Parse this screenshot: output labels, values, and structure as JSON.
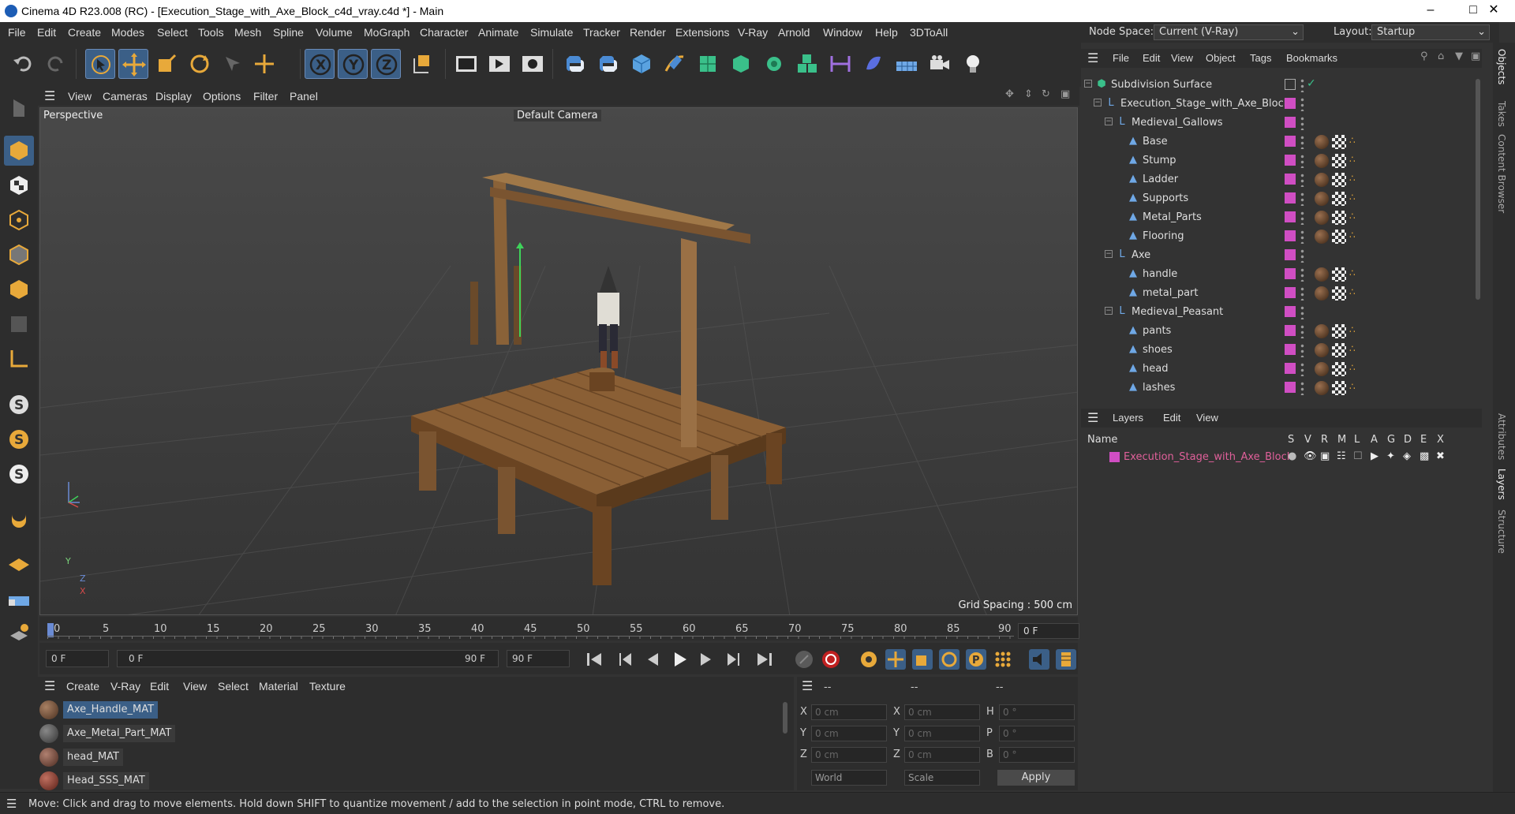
{
  "window": {
    "title": "Cinema 4D R23.008 (RC) - [Execution_Stage_with_Axe_Block_c4d_vray.c4d *] - Main",
    "minimize": "–",
    "maximize": "□",
    "close": "✕"
  },
  "menu": [
    "File",
    "Edit",
    "Create",
    "Modes",
    "Select",
    "Tools",
    "Mesh",
    "Spline",
    "Volume",
    "MoGraph",
    "Character",
    "Animate",
    "Simulate",
    "Tracker",
    "Render",
    "Extensions",
    "V-Ray",
    "Arnold",
    "Window",
    "Help",
    "3DToAll"
  ],
  "node_space": {
    "label": "Node Space:",
    "value": "Current (V-Ray)"
  },
  "layout": {
    "label": "Layout:",
    "value": "Startup"
  },
  "viewport_menu": [
    "View",
    "Cameras",
    "Display",
    "Options",
    "Filter",
    "Panel"
  ],
  "viewport": {
    "label": "Perspective",
    "camera": "Default Camera",
    "grid_spacing": "Grid Spacing : 500 cm",
    "axes": [
      "Y",
      "Z",
      "X"
    ]
  },
  "timeline": {
    "ticks": [
      "0",
      "5",
      "10",
      "15",
      "20",
      "25",
      "30",
      "35",
      "40",
      "45",
      "50",
      "55",
      "60",
      "65",
      "70",
      "75",
      "80",
      "85",
      "90"
    ],
    "current_frame": "0 F"
  },
  "transport": {
    "start": "0 F",
    "range_start": "0 F",
    "range_end": "90 F",
    "end": "90 F"
  },
  "material_menu": [
    "Create",
    "V-Ray",
    "Edit",
    "View",
    "Select",
    "Material",
    "Texture"
  ],
  "materials": [
    {
      "name": "Axe_Handle_MAT",
      "selected": true
    },
    {
      "name": "Axe_Metal_Part_MAT",
      "selected": false
    },
    {
      "name": "head_MAT",
      "selected": false
    },
    {
      "name": "Head_SSS_MAT",
      "selected": false
    }
  ],
  "coords": {
    "header": [
      "--",
      "--",
      "--"
    ],
    "rows": [
      {
        "a": "X",
        "av": "0 cm",
        "b": "X",
        "bv": "0 cm",
        "c": "H",
        "cv": "0 °"
      },
      {
        "a": "Y",
        "av": "0 cm",
        "b": "Y",
        "bv": "0 cm",
        "c": "P",
        "cv": "0 °"
      },
      {
        "a": "Z",
        "av": "0 cm",
        "b": "Z",
        "bv": "0 cm",
        "c": "B",
        "cv": "0 °"
      }
    ],
    "space": "World",
    "mode": "Scale",
    "apply": "Apply"
  },
  "status": "Move: Click and drag to move elements. Hold down SHIFT to quantize movement / add to the selection in point mode, CTRL to remove.",
  "object_menu": [
    "File",
    "Edit",
    "View",
    "Object",
    "Tags",
    "Bookmarks"
  ],
  "objects": [
    {
      "name": "Subdivision Surface",
      "indent": 0,
      "type": "subdiv"
    },
    {
      "name": "Execution_Stage_with_Axe_Block",
      "indent": 1,
      "type": "null"
    },
    {
      "name": "Medieval_Gallows",
      "indent": 2,
      "type": "null"
    },
    {
      "name": "Base",
      "indent": 3,
      "type": "mesh"
    },
    {
      "name": "Stump",
      "indent": 3,
      "type": "mesh"
    },
    {
      "name": "Ladder",
      "indent": 3,
      "type": "mesh"
    },
    {
      "name": "Supports",
      "indent": 3,
      "type": "mesh"
    },
    {
      "name": "Metal_Parts",
      "indent": 3,
      "type": "mesh"
    },
    {
      "name": "Flooring",
      "indent": 3,
      "type": "mesh"
    },
    {
      "name": "Axe",
      "indent": 2,
      "type": "null"
    },
    {
      "name": "handle",
      "indent": 3,
      "type": "mesh"
    },
    {
      "name": "metal_part",
      "indent": 3,
      "type": "mesh"
    },
    {
      "name": "Medieval_Peasant",
      "indent": 2,
      "type": "null"
    },
    {
      "name": "pants",
      "indent": 3,
      "type": "mesh"
    },
    {
      "name": "shoes",
      "indent": 3,
      "type": "mesh"
    },
    {
      "name": "head",
      "indent": 3,
      "type": "mesh"
    },
    {
      "name": "lashes",
      "indent": 3,
      "type": "mesh"
    }
  ],
  "layers_menu": [
    "Layers",
    "Edit",
    "View"
  ],
  "layers_header": {
    "name": "Name",
    "cols": [
      "S",
      "V",
      "R",
      "M",
      "L",
      "A",
      "G",
      "D",
      "E",
      "X"
    ]
  },
  "layers": [
    {
      "name": "Execution_Stage_with_Axe_Block",
      "color": "#d04ec3"
    }
  ],
  "side_tabs": [
    "Objects",
    "Takes",
    "Content Browser",
    "Attributes",
    "Layers",
    "Structure"
  ],
  "colors": {
    "accent": "#3b5f87",
    "layer_tag": "#d04ec3",
    "layer_name": "#e0609a"
  }
}
